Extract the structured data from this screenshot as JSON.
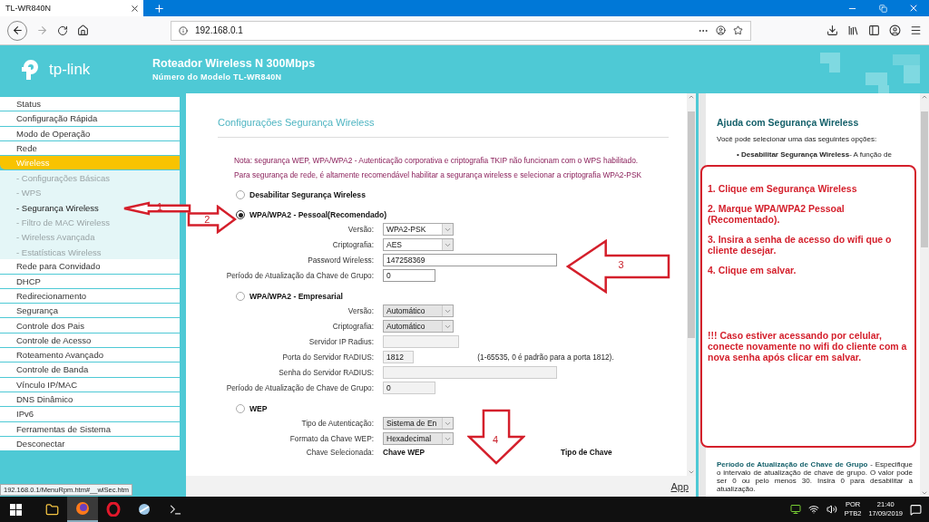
{
  "browser": {
    "tab_title": "TL-WR840N",
    "address": "192.168.0.1",
    "status_url": "192.168.0.1/MenuRpm.htm#__wlSec.htm"
  },
  "header": {
    "brand": "tp-link",
    "title": "Roteador Wireless N 300Mbps",
    "model": "Número do Modelo TL-WR840N"
  },
  "sidebar": {
    "items": [
      {
        "label": "Status",
        "kind": "main",
        "selected": false
      },
      {
        "label": "Configuração Rápida",
        "kind": "main",
        "selected": false
      },
      {
        "label": "Modo de Operação",
        "kind": "main",
        "selected": false
      },
      {
        "label": "Rede",
        "kind": "main",
        "selected": false
      },
      {
        "label": "Wireless",
        "kind": "main",
        "selected": true
      },
      {
        "label": "- Configurações Básicas",
        "kind": "sub",
        "selected": false
      },
      {
        "label": "- WPS",
        "kind": "sub",
        "selected": false
      },
      {
        "label": "- Segurança Wireless",
        "kind": "sub",
        "selected": true
      },
      {
        "label": "- Filtro de MAC Wireless",
        "kind": "sub",
        "selected": false
      },
      {
        "label": "- Wireless Avançada",
        "kind": "sub",
        "selected": false
      },
      {
        "label": "- Estatísticas Wireless",
        "kind": "sub",
        "selected": false
      },
      {
        "label": "Rede para Convidado",
        "kind": "main",
        "selected": false
      },
      {
        "label": "DHCP",
        "kind": "main",
        "selected": false
      },
      {
        "label": "Redirecionamento",
        "kind": "main",
        "selected": false
      },
      {
        "label": "Segurança",
        "kind": "main",
        "selected": false
      },
      {
        "label": "Controle dos Pais",
        "kind": "main",
        "selected": false
      },
      {
        "label": "Controle de Acesso",
        "kind": "main",
        "selected": false
      },
      {
        "label": "Roteamento Avançado",
        "kind": "main",
        "selected": false
      },
      {
        "label": "Controle de Banda",
        "kind": "main",
        "selected": false
      },
      {
        "label": "Vínculo IP/MAC",
        "kind": "main",
        "selected": false
      },
      {
        "label": "DNS Dinâmico",
        "kind": "main",
        "selected": false
      },
      {
        "label": "IPv6",
        "kind": "main",
        "selected": false
      },
      {
        "label": "Ferramentas de Sistema",
        "kind": "main",
        "selected": false
      },
      {
        "label": "Desconectar",
        "kind": "main",
        "selected": false
      }
    ]
  },
  "main": {
    "title": "Configurações Segurança Wireless",
    "notes": [
      "Nota: segurança WEP, WPA/WPA2 - Autenticação corporativa e criptografia TKIP não funcionam com o WPS habilitado.",
      "Para segurança de rede, é altamente recomendável habilitar a segurança wireless e selecionar a criptografia WPA2-PSK"
    ],
    "options": [
      {
        "label": "Desabilitar Segurança Wireless",
        "selected": false
      },
      {
        "label": "WPA/WPA2 - Pessoal(Recomendado)",
        "selected": true,
        "fields": [
          {
            "label": "Versão:",
            "kind": "select",
            "value": "WPA2-PSK",
            "disabled": false
          },
          {
            "label": "Criptografia:",
            "kind": "select",
            "value": "AES",
            "disabled": false
          },
          {
            "label": "Password Wireless:",
            "kind": "wide",
            "value": "147258369",
            "disabled": false
          },
          {
            "label": "Período de Atualização da Chave de Grupo:",
            "kind": "input",
            "value": "0",
            "disabled": false
          }
        ]
      },
      {
        "label": "WPA/WPA2 - Empresarial",
        "selected": false,
        "fields": [
          {
            "label": "Versão:",
            "kind": "select",
            "value": "Automático",
            "disabled": true
          },
          {
            "label": "Criptografia:",
            "kind": "select",
            "value": "Automático",
            "disabled": true
          },
          {
            "label": "Servidor IP Radius:",
            "kind": "input",
            "disabled": true
          },
          {
            "label": "Porta do Servidor RADIUS:",
            "kind": "short",
            "value": "1812",
            "hint": "(1-65535, 0 é padrão para a porta 1812).",
            "disabled": true
          },
          {
            "label": "Senha do Servidor RADIUS:",
            "kind": "wide",
            "disabled": true
          },
          {
            "label": "Período de Atualização de Chave de Grupo:",
            "kind": "input",
            "value": "0",
            "disabled": true
          }
        ]
      },
      {
        "label": "WEP",
        "selected": false,
        "fields": [
          {
            "label": "Tipo de Autenticação:",
            "kind": "select",
            "value": "Sistema de En",
            "disabled": true
          },
          {
            "label": "Formato da Chave WEP:",
            "kind": "select",
            "value": "Hexadecimal",
            "disabled": true
          },
          {
            "label": "Chave Selecionada:",
            "kind": "heading",
            "columns": [
              "Chave WEP",
              "Tipo de Chave"
            ]
          }
        ]
      }
    ],
    "apply_link": "App"
  },
  "help": {
    "title": "Ajuda com Segurança Wireless",
    "intro": "Você pode selecionar uma das seguintes opções:",
    "bullet": "• **Desabilitar Segurança Wireless**- A função de",
    "section_title": "Período de Atualização de Chave de Grupo",
    "section_text": "- Especifique o intervalo de atualização de chave de grupo. O valor pode ser 0 ou pelo menos 30. Insira 0 para desabilitar a atualização."
  },
  "annotations": {
    "arrows": [
      {
        "label": "1",
        "kind": "left"
      },
      {
        "label": "2",
        "kind": "right"
      },
      {
        "label": "3",
        "kind": "left"
      },
      {
        "label": "4",
        "kind": "down"
      }
    ],
    "steps": [
      "1. Clique em Segurança Wireless",
      "2. Marque WPA/WPA2 Pessoal (Recomentado).",
      "3. Insira a senha de acesso do wifi que o cliente desejar.",
      "4. Clique em salvar."
    ],
    "warning": "!!! Caso estiver acessando por celular, conecte novamente no wifi do cliente com a nova senha após clicar em salvar."
  },
  "taskbar": {
    "language": "POR",
    "layout": "PTB2",
    "time": "21:40",
    "date": "17/09/2019"
  }
}
